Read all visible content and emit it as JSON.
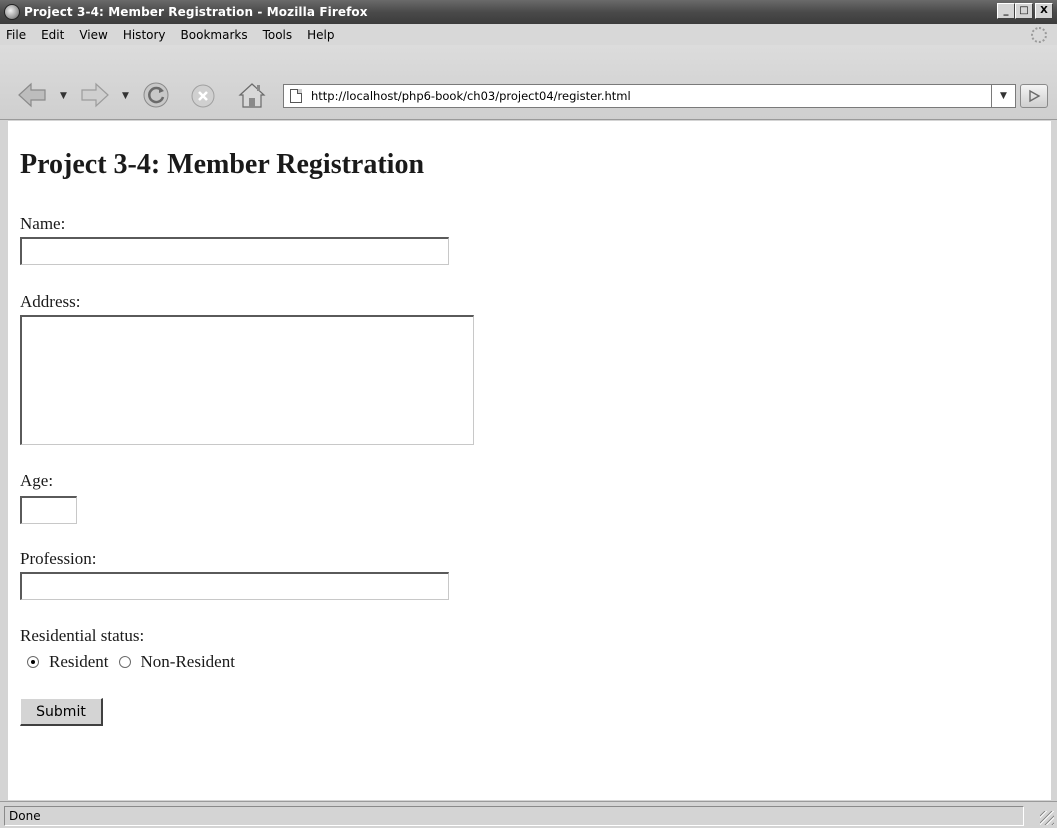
{
  "window": {
    "title": "Project 3-4: Member Registration - Mozilla Firefox",
    "controls": {
      "minimize": "_",
      "maximize": "□",
      "close": "X"
    }
  },
  "menu": [
    "File",
    "Edit",
    "View",
    "History",
    "Bookmarks",
    "Tools",
    "Help"
  ],
  "toolbar": {
    "icons": [
      "back-arrow-icon",
      "forward-arrow-icon",
      "reload-icon",
      "stop-icon",
      "home-icon"
    ],
    "url": "http://localhost/php6-book/ch03/project04/register.html"
  },
  "page": {
    "heading": "Project 3-4: Member Registration",
    "form": {
      "name_label": "Name:",
      "name_value": "",
      "address_label": "Address:",
      "address_value": "",
      "age_label": "Age:",
      "age_value": "",
      "profession_label": "Profession:",
      "profession_value": "",
      "residential_label": "Residential status:",
      "radio_options": [
        {
          "label": "Resident",
          "selected": true
        },
        {
          "label": "Non-Resident",
          "selected": false
        }
      ],
      "submit_label": "Submit"
    }
  },
  "status": {
    "text": "Done"
  }
}
